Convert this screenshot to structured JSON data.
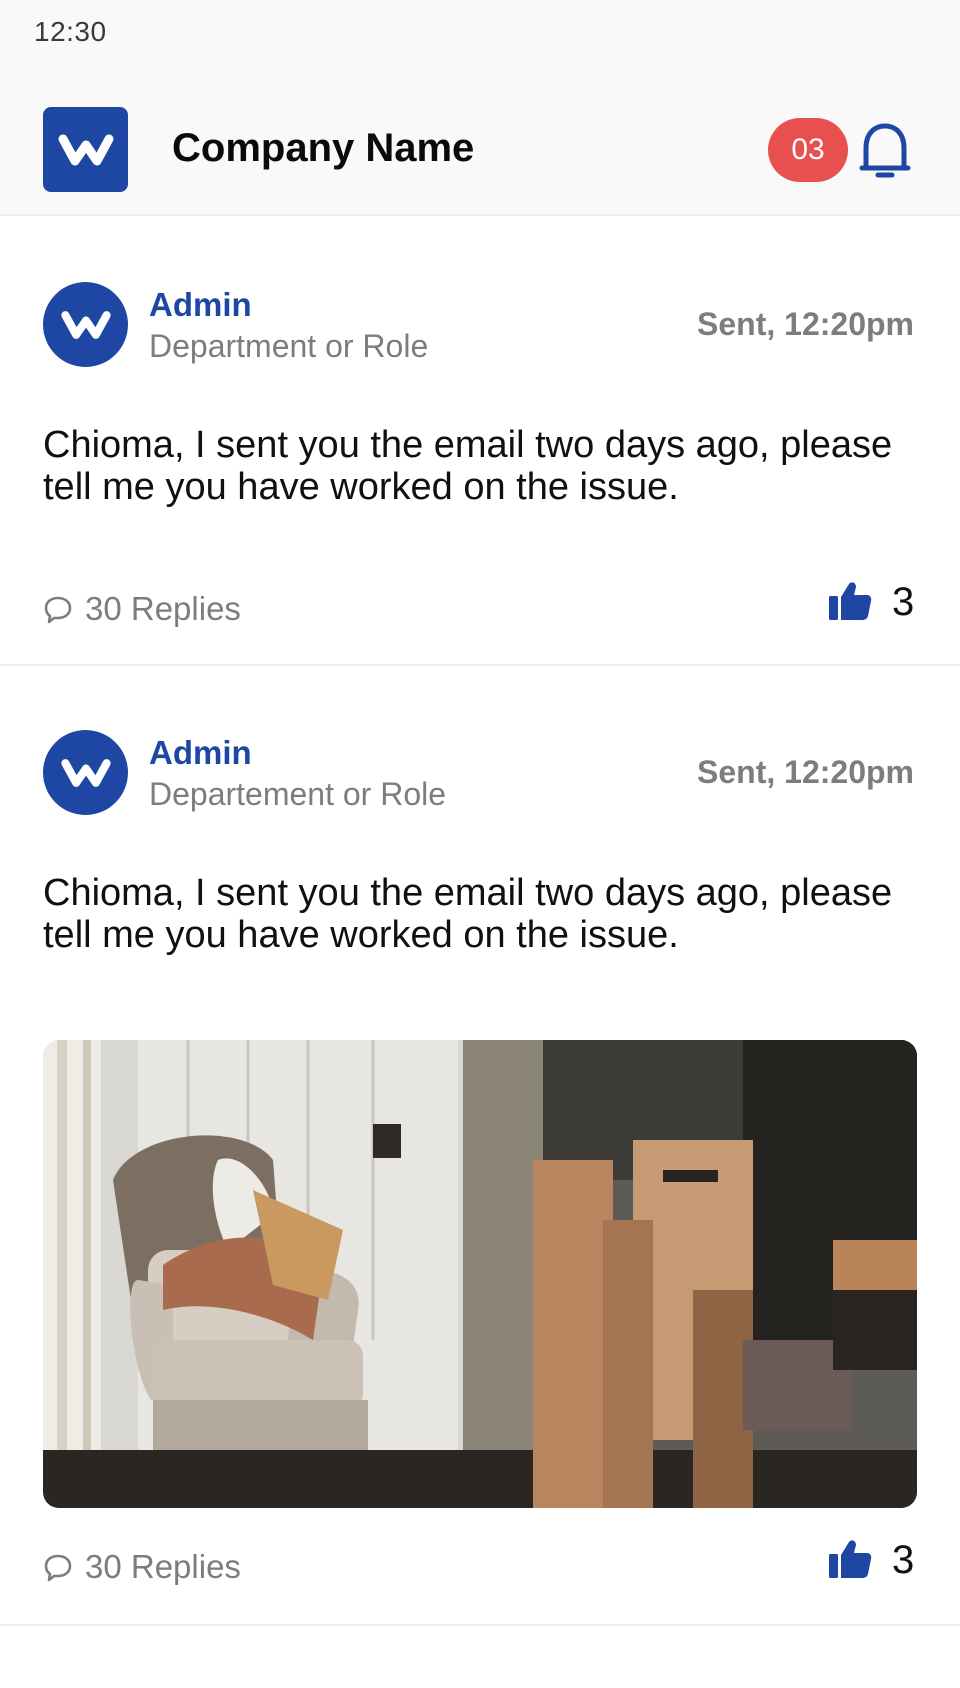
{
  "status_bar": {
    "time": "12:30"
  },
  "header": {
    "logo_icon": "w-logo-icon",
    "company_name": "Company Name",
    "notification_count": "03",
    "notification_icon": "bell-icon",
    "brand_color": "#1e47a3",
    "badge_color": "#e8504f"
  },
  "posts": [
    {
      "author": "Admin",
      "role": "Department or Role",
      "sent": "Sent, 12:20pm",
      "message": "Chioma, I sent you the email two days ago, please tell me you have worked on the issue.",
      "replies": "30 Replies",
      "likes": "3",
      "has_image": false
    },
    {
      "author": "Admin",
      "role": "Departement or Role",
      "sent": "Sent, 12:20pm",
      "message": "Chioma, I sent you the email two days ago, please tell me you have worked on the issue.",
      "replies": "30 Replies",
      "likes": "3",
      "has_image": true
    }
  ]
}
